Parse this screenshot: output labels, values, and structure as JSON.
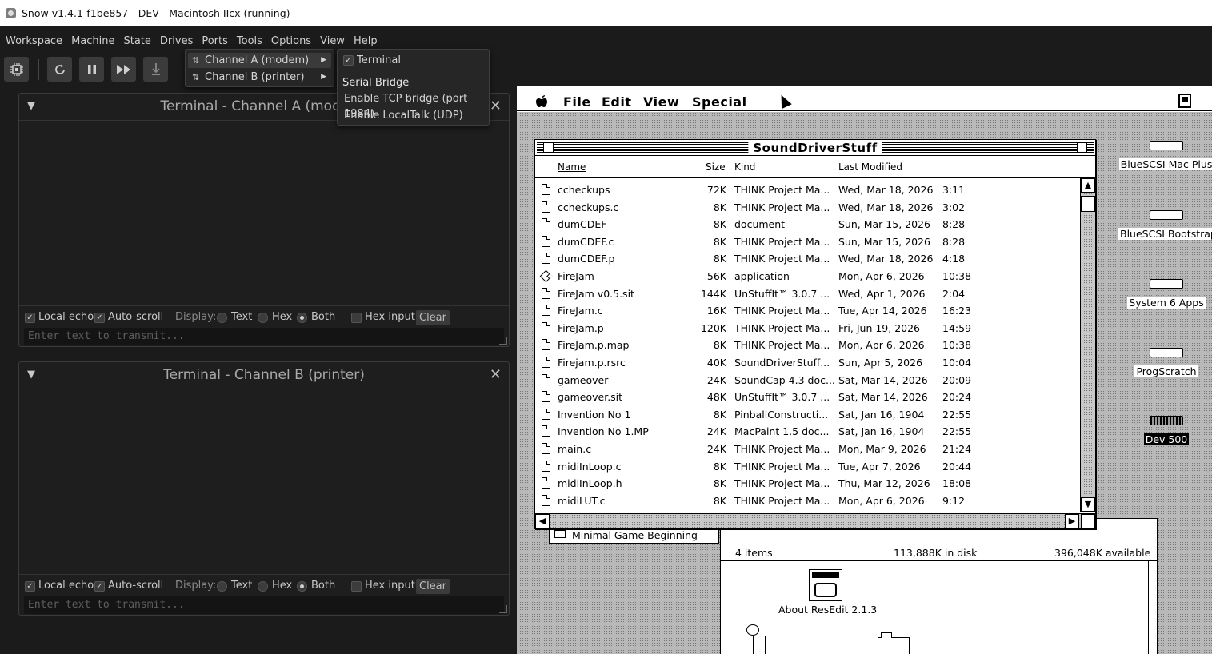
{
  "window": {
    "title": "Snow v1.4.1-f1be857 - DEV - Macintosh IIcx (running)"
  },
  "menubar": [
    "Workspace",
    "Machine",
    "State",
    "Drives",
    "Ports",
    "Tools",
    "Options",
    "View",
    "Help"
  ],
  "ports_menu": {
    "items": [
      {
        "label": "Channel A (modem)"
      },
      {
        "label": "Channel B (printer)"
      }
    ],
    "submenu": {
      "terminal": "Terminal",
      "terminal_checked": true,
      "section": "Serial Bridge",
      "tcp": "Enable TCP bridge (port 1984)",
      "localtalk": "Enable LocalTalk (UDP)"
    }
  },
  "terminals": [
    {
      "title": "Terminal - Channel A (modem)",
      "local_echo": "Local echo",
      "auto_scroll": "Auto-scroll",
      "display": "Display:",
      "text": "Text",
      "hex": "Hex",
      "both": "Both",
      "hex_input": "Hex input",
      "clear": "Clear",
      "placeholder": "Enter text to transmit..."
    },
    {
      "title": "Terminal - Channel B (printer)",
      "local_echo": "Local echo",
      "auto_scroll": "Auto-scroll",
      "display": "Display:",
      "text": "Text",
      "hex": "Hex",
      "both": "Both",
      "hex_input": "Hex input",
      "clear": "Clear",
      "placeholder": "Enter text to transmit..."
    }
  ],
  "mac": {
    "menu": [
      "File",
      "Edit",
      "View",
      "Special"
    ],
    "finder_window": {
      "title": "SoundDriverStuff",
      "columns": [
        "Name",
        "Size",
        "Kind",
        "Last Modified"
      ],
      "files": [
        {
          "name": "ccheckups",
          "size": "72K",
          "kind": "THINK Project Ma...",
          "date": "Wed, Mar 18, 2026",
          "time": "3:11"
        },
        {
          "name": "ccheckups.c",
          "size": "8K",
          "kind": "THINK Project Ma...",
          "date": "Wed, Mar 18, 2026",
          "time": "3:02"
        },
        {
          "name": "dumCDEF",
          "size": "8K",
          "kind": "document",
          "date": "Sun, Mar 15, 2026",
          "time": "8:28"
        },
        {
          "name": "dumCDEF.c",
          "size": "8K",
          "kind": "THINK Project Ma...",
          "date": "Sun, Mar 15, 2026",
          "time": "8:28"
        },
        {
          "name": "dumCDEF.p",
          "size": "8K",
          "kind": "THINK Project Ma...",
          "date": "Wed, Mar 18, 2026",
          "time": "4:18"
        },
        {
          "name": "FireJam",
          "size": "56K",
          "kind": "application",
          "date": "Mon, Apr 6, 2026",
          "time": "10:38"
        },
        {
          "name": "FireJam v0.5.sit",
          "size": "144K",
          "kind": "UnStuffIt™ 3.0.7 ...",
          "date": "Wed, Apr 1, 2026",
          "time": "2:04"
        },
        {
          "name": "FireJam.c",
          "size": "16K",
          "kind": "THINK Project Ma...",
          "date": "Tue, Apr 14, 2026",
          "time": "16:23"
        },
        {
          "name": "FireJam.p",
          "size": "120K",
          "kind": "THINK Project Ma...",
          "date": "Fri, Jun 19, 2026",
          "time": "14:59"
        },
        {
          "name": "FireJam.p.map",
          "size": "8K",
          "kind": "THINK Project Ma...",
          "date": "Mon, Apr 6, 2026",
          "time": "10:38"
        },
        {
          "name": "Firejam.p.rsrc",
          "size": "40K",
          "kind": "SoundDriverStuff...",
          "date": "Sun, Apr 5, 2026",
          "time": "10:04"
        },
        {
          "name": "gameover",
          "size": "24K",
          "kind": "SoundCap 4.3 doc...",
          "date": "Sat, Mar 14, 2026",
          "time": "20:09"
        },
        {
          "name": "gameover.sit",
          "size": "48K",
          "kind": "UnStuffIt™ 3.0.7 ...",
          "date": "Sat, Mar 14, 2026",
          "time": "20:24"
        },
        {
          "name": "Invention No 1",
          "size": "8K",
          "kind": "PinballConstructi...",
          "date": "Sat, Jan 16, 1904",
          "time": "22:55"
        },
        {
          "name": "Invention No 1.MP",
          "size": "24K",
          "kind": "MacPaint 1.5 doc...",
          "date": "Sat, Jan 16, 1904",
          "time": "22:55"
        },
        {
          "name": "main.c",
          "size": "24K",
          "kind": "THINK Project Ma...",
          "date": "Mon, Mar 9, 2026",
          "time": "21:24"
        },
        {
          "name": "midiInLoop.c",
          "size": "8K",
          "kind": "THINK Project Ma...",
          "date": "Tue, Apr 7, 2026",
          "time": "20:44"
        },
        {
          "name": "midiInLoop.h",
          "size": "8K",
          "kind": "THINK Project Ma...",
          "date": "Thu, Mar 12, 2026",
          "time": "18:08"
        },
        {
          "name": "midiLUT.c",
          "size": "8K",
          "kind": "THINK Project Ma...",
          "date": "Mon, Apr 6, 2026",
          "time": "9:12"
        }
      ]
    },
    "folder_behind": "Minimal Game Beginning",
    "resedit_window": {
      "items": "4 items",
      "disk": "113,888K in disk",
      "available": "396,048K available",
      "icon_label": "About ResEdit 2.1.3"
    },
    "desktop_icons": [
      "BlueSCSI Mac Plus",
      "BlueSCSI Bootstrap",
      "System 6 Apps",
      "ProgScratch",
      "Dev 500"
    ]
  }
}
